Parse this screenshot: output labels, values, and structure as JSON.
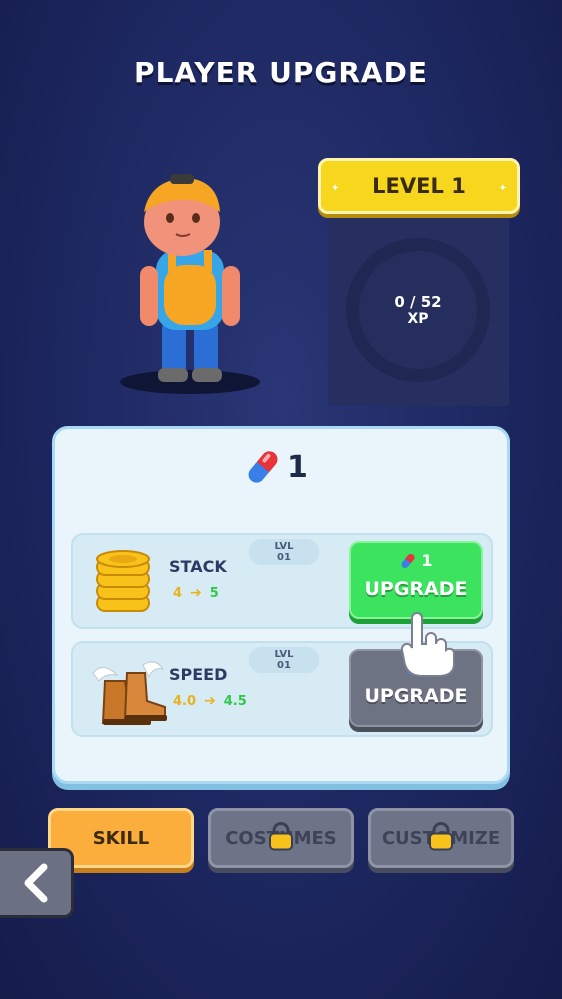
{
  "header": {
    "title": "PLAYER UPGRADE"
  },
  "level": {
    "label": "LEVEL 1",
    "xp_value": "0 / 52",
    "xp_unit": "XP",
    "xp_progress": 0
  },
  "currency": {
    "icon": "pill-capsule-icon",
    "count": "1"
  },
  "skills": [
    {
      "name": "STACK",
      "lvl_label": "LVL",
      "lvl_value": "01",
      "from": "4",
      "to": "5",
      "cost": "1",
      "button": "UPGRADE",
      "enabled": true,
      "icon": "coin-stack-icon"
    },
    {
      "name": "SPEED",
      "lvl_label": "LVL",
      "lvl_value": "01",
      "from": "4.0",
      "to": "4.5",
      "cost": "",
      "button": "UPGRADE",
      "enabled": false,
      "icon": "winged-boots-icon"
    }
  ],
  "tabs": [
    {
      "label": "SKILL",
      "locked": false
    },
    {
      "label": "COSTUMES",
      "locked": true
    },
    {
      "label": "CUSTOMIZE",
      "locked": true
    }
  ],
  "nav": {
    "back_icon": "chevron-left-icon"
  },
  "colors": {
    "accent_yellow": "#f7d61e",
    "upgrade_green": "#3be35e",
    "tab_active": "#fbae3c",
    "background": "#1d2760"
  }
}
